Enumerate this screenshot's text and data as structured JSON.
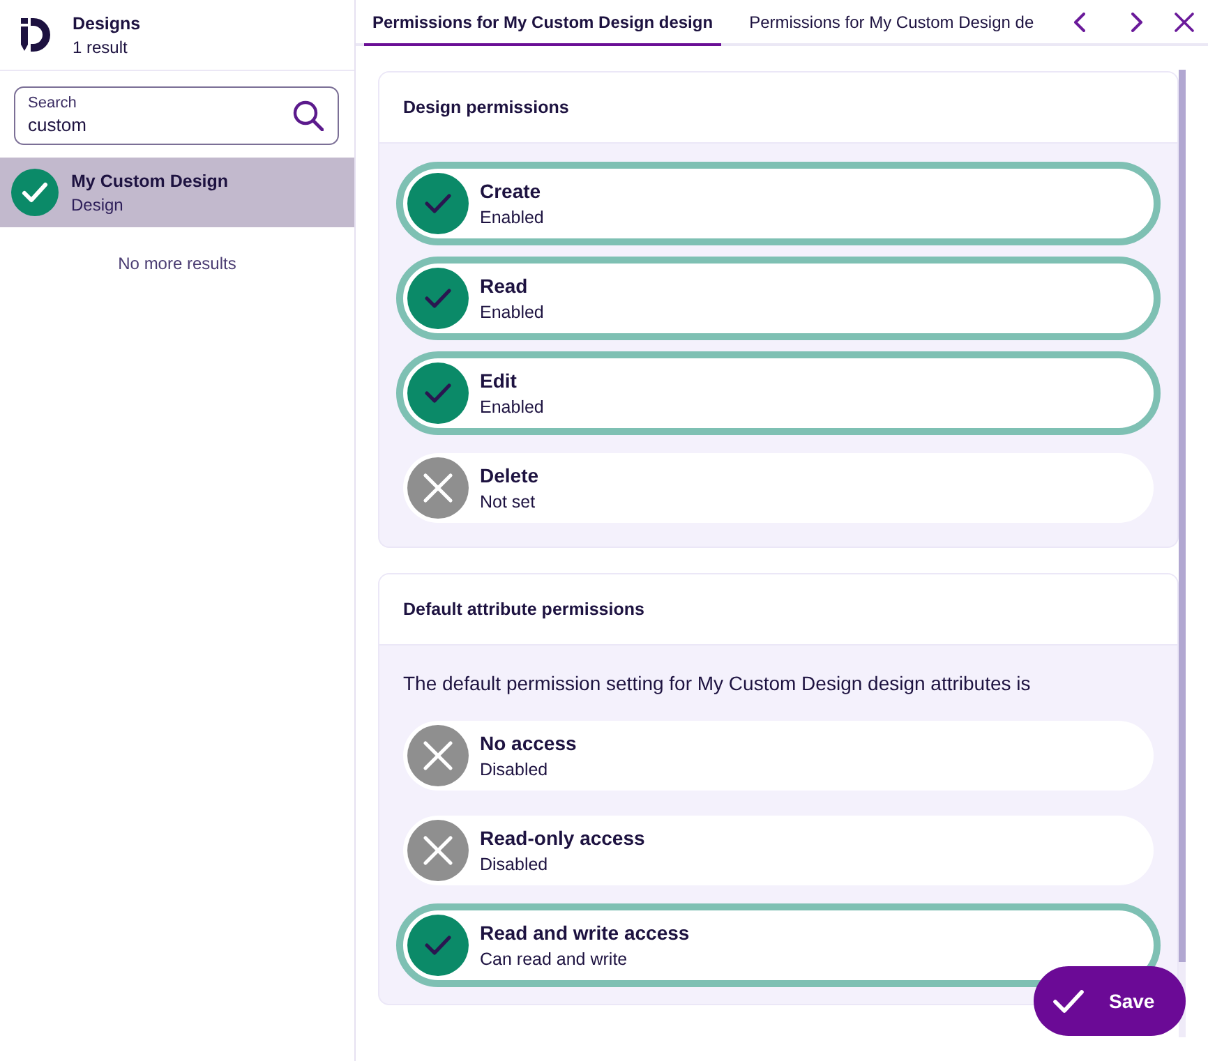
{
  "sidebar": {
    "title": "Designs",
    "result_count": "1 result",
    "search": {
      "label": "Search",
      "value": "custom"
    },
    "results": [
      {
        "title": "My Custom Design",
        "type": "Design",
        "selected": true
      }
    ],
    "end_message": "No more results"
  },
  "tabs": [
    {
      "label": "Permissions for My Custom Design design",
      "selected": true
    },
    {
      "label": "Permissions for My Custom Design de",
      "selected": false
    }
  ],
  "sections": [
    {
      "title": "Design permissions",
      "options": [
        {
          "name": "Create",
          "status": "Enabled",
          "selected": true
        },
        {
          "name": "Read",
          "status": "Enabled",
          "selected": true
        },
        {
          "name": "Edit",
          "status": "Enabled",
          "selected": true
        },
        {
          "name": "Delete",
          "status": "Not set",
          "selected": false
        }
      ]
    },
    {
      "title": "Default attribute permissions",
      "description": "The default permission setting for My Custom Design design attributes is",
      "options": [
        {
          "name": "No access",
          "status": "Disabled",
          "selected": false
        },
        {
          "name": "Read-only access",
          "status": "Disabled",
          "selected": false
        },
        {
          "name": "Read and write access",
          "status": "Can read and write",
          "selected": true
        }
      ]
    }
  ],
  "save_button": {
    "label": "Save"
  }
}
